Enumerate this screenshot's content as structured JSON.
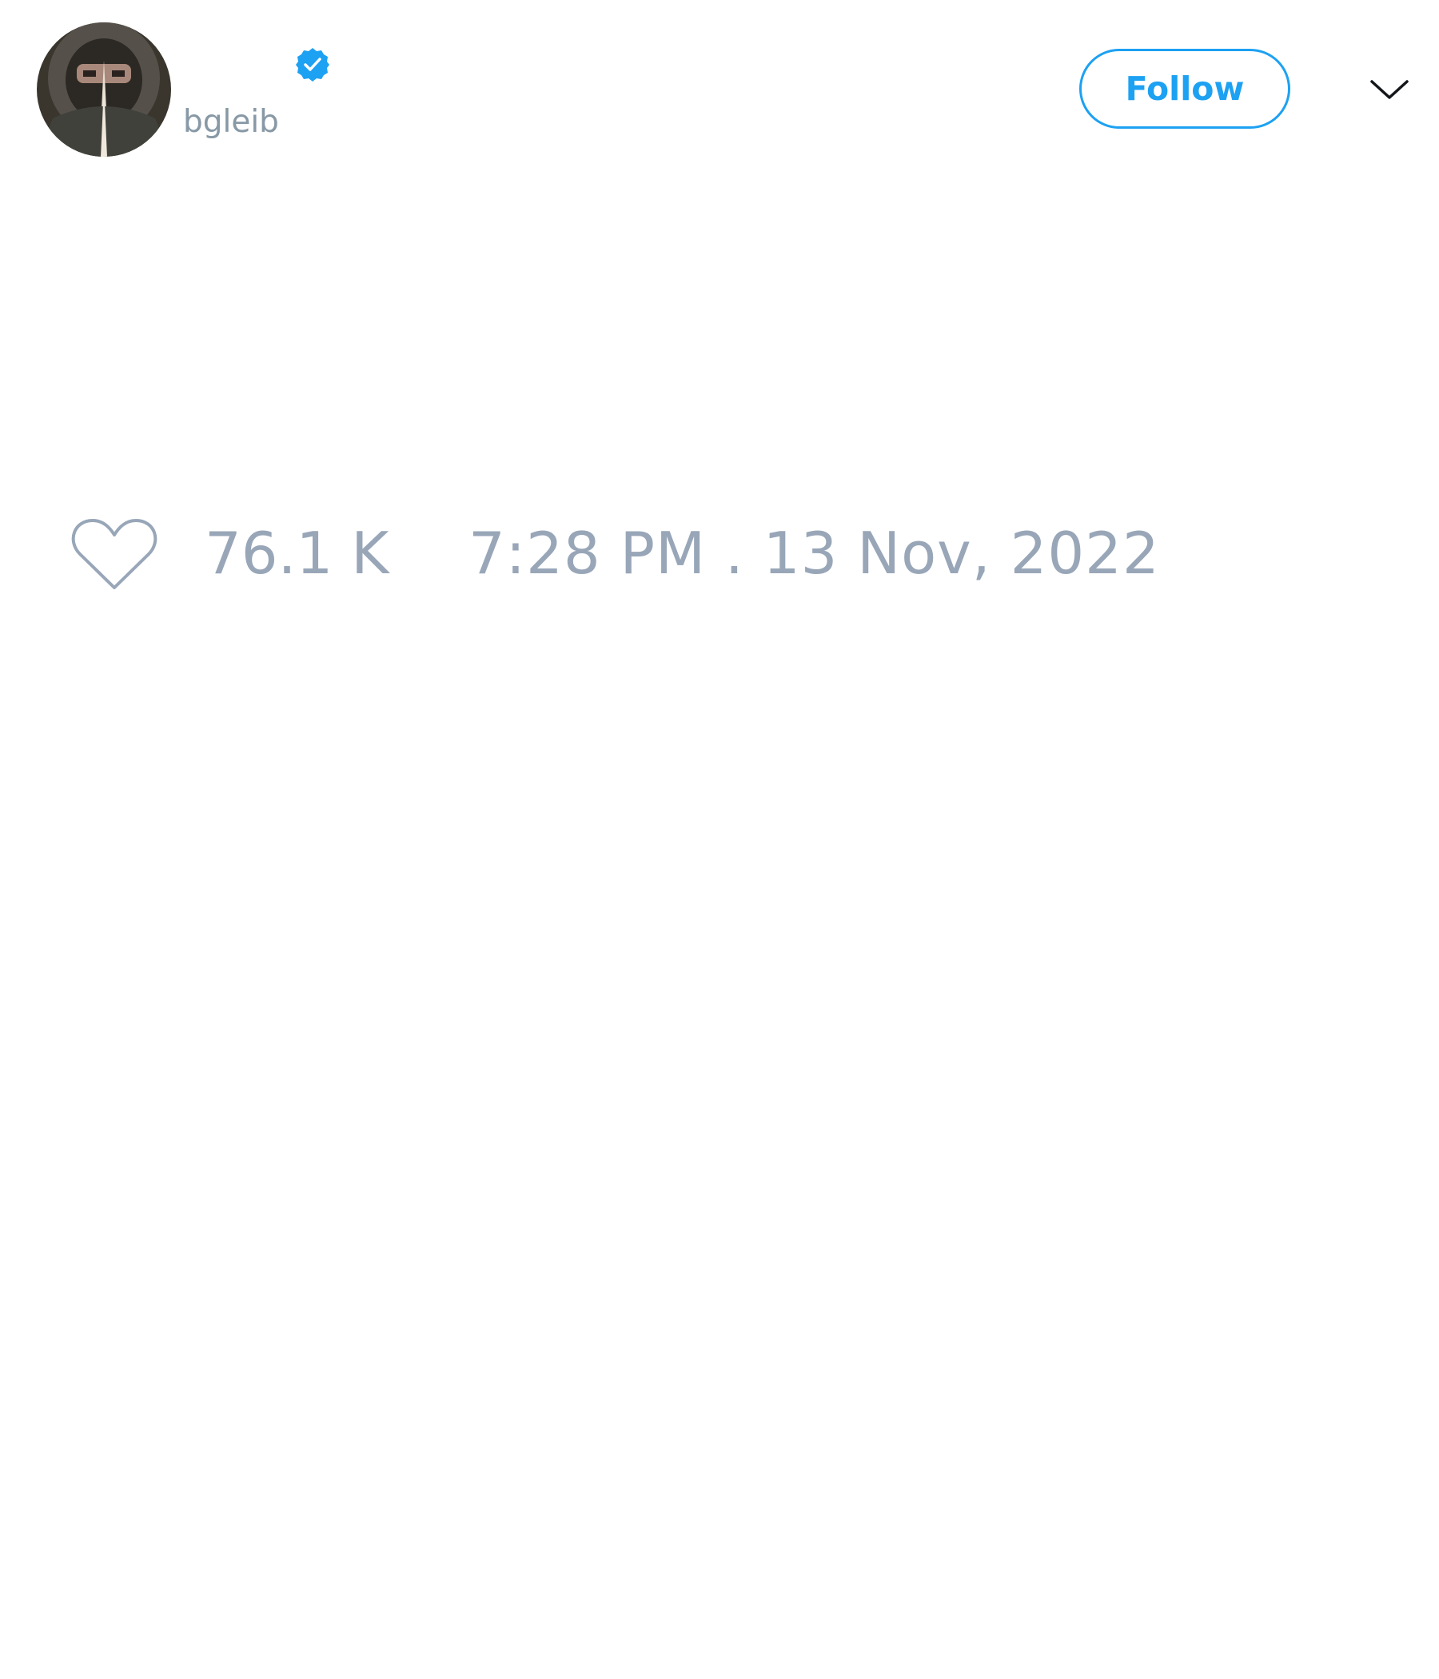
{
  "tweet": {
    "author": {
      "display_name": "",
      "handle": "bgleib",
      "verified": true,
      "avatar_icon": "user-avatar-hooded-figure"
    },
    "follow_label": "Follow",
    "more_icon": "chevron-down-icon",
    "like_icon": "heart-outline-icon",
    "likes": "76.1 K",
    "timestamp": "7:28 PM . 13 Nov, 2022"
  },
  "colors": {
    "accent": "#1da1f2",
    "muted_text": "#98a6b8",
    "handle_text": "#8899a6",
    "background": "#ffffff"
  }
}
